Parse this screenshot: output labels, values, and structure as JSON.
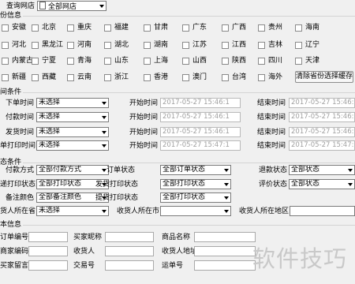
{
  "store_query": {
    "label": "查询网店",
    "selected": "全部网店",
    "icon": "document-icon"
  },
  "province": {
    "section_title": "份信息",
    "rows": [
      [
        "安徽",
        "北京",
        "重庆",
        "福建",
        "甘肃",
        "广东",
        "广西",
        "贵州",
        "海南"
      ],
      [
        "河北",
        "黑龙江",
        "河南",
        "湖北",
        "湖南",
        "江苏",
        "江西",
        "吉林",
        "辽宁"
      ],
      [
        "内蒙古",
        "宁夏",
        "青海",
        "山东",
        "上海",
        "山西",
        "陕西",
        "四川",
        "天津"
      ],
      [
        "新疆",
        "西藏",
        "云南",
        "浙江",
        "香港",
        "澳门",
        "台湾",
        "海外"
      ]
    ],
    "clear_button": "清除省份选择缓存"
  },
  "time_conditions": {
    "section_title": "间条件",
    "rows": [
      {
        "label": "下单时间",
        "select": "未选择",
        "start_label": "开始时间",
        "start": "2017-05-27 15:46:1",
        "end_label": "结束时间",
        "end": "2017-05-27 15:46:1"
      },
      {
        "label": "付款时间",
        "select": "未选择",
        "start_label": "开始时间",
        "start": "2017-05-27 15:46:1",
        "end_label": "结束时间",
        "end": "2017-05-27 15:46:1"
      },
      {
        "label": "发货时间",
        "select": "未选择",
        "start_label": "开始时间",
        "start": "2017-05-27 15:46:1",
        "end_label": "结束时间",
        "end": "2017-05-27 15:46:1"
      },
      {
        "label": "单打印时间",
        "select": "未选择",
        "start_label": "开始时间",
        "start": "2017-05-27 15:47:1",
        "end_label": "结束时间",
        "end": "2017-05-27 15:47:1"
      }
    ]
  },
  "status_conditions": {
    "section_title": "态条件",
    "rows": [
      [
        {
          "label": "付款方式",
          "value": "全部付款方式"
        },
        {
          "label": "订单状态",
          "value": "全部订单状态"
        },
        {
          "label": "退款状态",
          "value": "全部状态"
        }
      ],
      [
        {
          "label": "递打印状态",
          "value": "全部打印状态"
        },
        {
          "label": "发货打印状态",
          "value": "全部打印状态"
        },
        {
          "label": "评价状态",
          "value": "全部状态"
        }
      ],
      [
        {
          "label": "备注颜色",
          "value": "全部备注颜色"
        },
        {
          "label": "提货打印状态",
          "value": "全部打印状态"
        }
      ]
    ],
    "location": {
      "buyer_province_label": "货人所在省",
      "buyer_province": "未选择",
      "city_label": "收货人所在市",
      "city": "",
      "district_label": "收货人所在地区",
      "district": ""
    }
  },
  "basic_info": {
    "section_title": "本信息",
    "fields": [
      [
        "订单编号",
        "买家昵称",
        "商品名称"
      ],
      [
        "商家编码",
        "收货人",
        "收货人地址"
      ],
      [
        "买家留言",
        "交易号",
        "运单号"
      ]
    ]
  },
  "watermark": "软件技巧"
}
